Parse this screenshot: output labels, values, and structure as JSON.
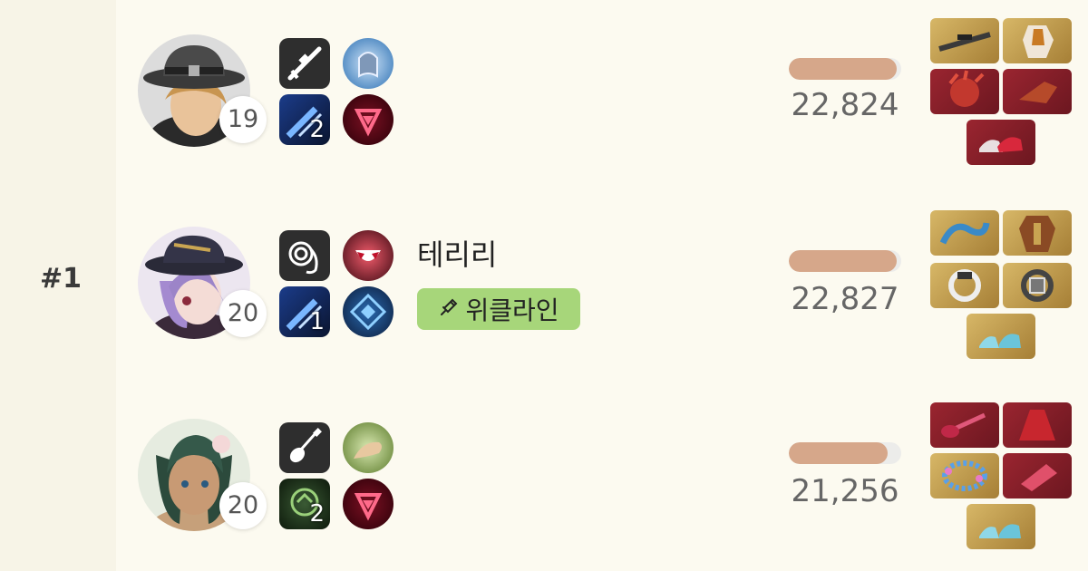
{
  "rank": "#1",
  "players": [
    {
      "level": "19",
      "name": "",
      "tag": "",
      "score": "22,824",
      "damage_fraction": 0.96,
      "weapon_icon": "sniper-rifle-icon",
      "skill_count": "2",
      "items": [
        {
          "icon": "sniper-rifle-item-icon",
          "rarity": "gold"
        },
        {
          "icon": "chest-armor-item-icon",
          "rarity": "gold"
        },
        {
          "icon": "red-helmet-item-icon",
          "rarity": "red"
        },
        {
          "icon": "red-gauntlet-item-icon",
          "rarity": "red"
        },
        {
          "icon": "red-shoes-item-icon",
          "rarity": "red"
        }
      ]
    },
    {
      "level": "20",
      "name": "테리리",
      "tag": "위클라인",
      "score": "22,827",
      "damage_fraction": 0.96,
      "weapon_icon": "whip-icon",
      "skill_count": "1",
      "items": [
        {
          "icon": "blue-whip-item-icon",
          "rarity": "gold"
        },
        {
          "icon": "leather-armor-item-icon",
          "rarity": "gold"
        },
        {
          "icon": "silver-ring-item-icon",
          "rarity": "gold"
        },
        {
          "icon": "dark-ring-item-icon",
          "rarity": "gold"
        },
        {
          "icon": "blue-heels-item-icon",
          "rarity": "gold"
        }
      ]
    },
    {
      "level": "20",
      "name": "",
      "tag": "",
      "score": "21,256",
      "damage_fraction": 0.88,
      "weapon_icon": "guitar-icon",
      "skill_count": "2",
      "items": [
        {
          "icon": "red-guitar-item-icon",
          "rarity": "red"
        },
        {
          "icon": "red-dress-item-icon",
          "rarity": "red"
        },
        {
          "icon": "flower-wreath-item-icon",
          "rarity": "gold"
        },
        {
          "icon": "red-bracer-item-icon",
          "rarity": "red"
        },
        {
          "icon": "blue-heels-item-icon",
          "rarity": "gold"
        }
      ]
    }
  ],
  "colors": {
    "background": "#fcfaf0",
    "bar_fill": "#d6a78a",
    "tag_green": "#a7d67a",
    "item_gold": "#c9a552",
    "item_red": "#8a1f2a"
  }
}
